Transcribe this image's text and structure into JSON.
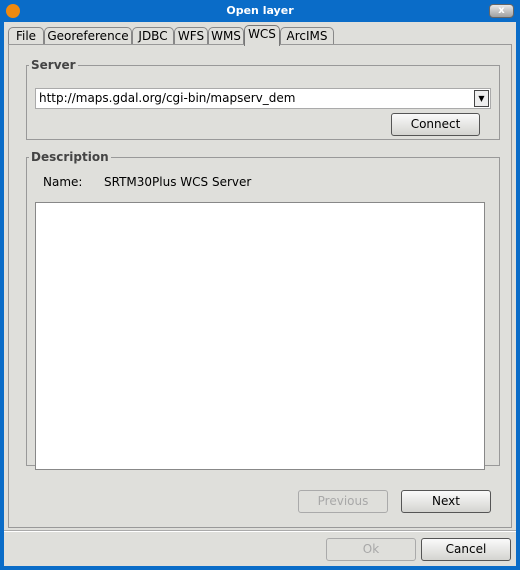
{
  "window": {
    "title": "Open layer",
    "close_label": "x"
  },
  "tabs": [
    {
      "label": "File"
    },
    {
      "label": "Georeference"
    },
    {
      "label": "JDBC"
    },
    {
      "label": "WFS"
    },
    {
      "label": "WMS"
    },
    {
      "label": "WCS",
      "selected": true
    },
    {
      "label": "ArcIMS"
    }
  ],
  "server": {
    "legend": "Server",
    "url": "http://maps.gdal.org/cgi-bin/mapserv_dem",
    "connect_label": "Connect"
  },
  "description": {
    "legend": "Description",
    "name_label": "Name:",
    "name_value": "SRTM30Plus WCS Server",
    "text": ""
  },
  "nav": {
    "previous_label": "Previous",
    "next_label": "Next"
  },
  "footer": {
    "ok_label": "Ok",
    "cancel_label": "Cancel"
  },
  "colors": {
    "title_bar": "#0a6cc8",
    "background": "#dfdfdb"
  }
}
